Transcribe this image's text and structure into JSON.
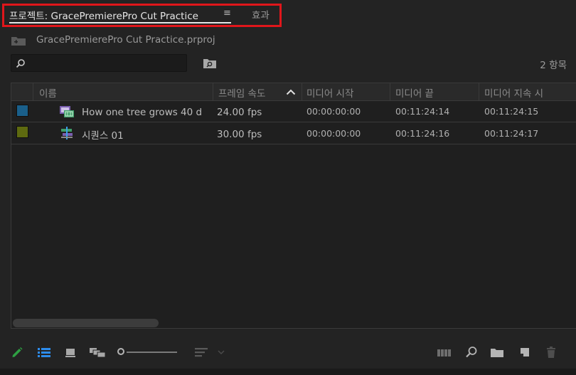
{
  "tabs": {
    "project_label": "프로젝트: GracePremierePro Cut Practice",
    "menu_glyph": "≡",
    "effects_label": "효과"
  },
  "project": {
    "filename": "GracePremierePro Cut Practice.prproj",
    "item_count": "2 항목"
  },
  "search": {
    "value": "",
    "placeholder": ""
  },
  "table": {
    "headers": {
      "name": "이름",
      "frame_rate": "프레임 속도",
      "media_start": "미디어 시작",
      "media_end": "미디어 끝",
      "media_duration": "미디어 지속 시"
    },
    "rows": [
      {
        "label_color": "#1a5f8a",
        "icon": "video-clip-icon",
        "name": "How one tree grows 40 d",
        "frame_rate": "24.00 fps",
        "media_start": "00:00:00:00",
        "media_end": "00:11:24:14",
        "media_duration": "00:11:24:15"
      },
      {
        "label_color": "#5e6a10",
        "icon": "sequence-icon",
        "name": "시퀀스 01",
        "frame_rate": "30.00 fps",
        "media_start": "00:00:00:00",
        "media_end": "00:11:24:16",
        "media_duration": "00:11:24:17"
      }
    ]
  },
  "toolbar": {
    "icons": [
      "pencil-icon",
      "list-view-icon",
      "icon-view-icon",
      "freeform-view-icon",
      "zoom-slider",
      "sort-icons-icon",
      "automate-to-sequence-icon",
      "find-icon",
      "new-bin-icon",
      "new-item-icon",
      "trash-icon"
    ]
  },
  "colors": {
    "accent_blue": "#2d8ceb",
    "highlight_red": "#e0161b",
    "pencil_green": "#2ea043"
  }
}
